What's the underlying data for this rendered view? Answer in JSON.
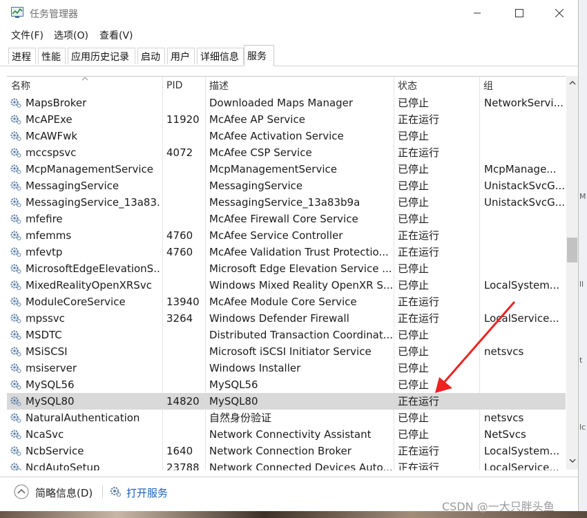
{
  "window": {
    "title": "任务管理器"
  },
  "menu": [
    "文件(F)",
    "选项(O)",
    "查看(V)"
  ],
  "tabs": [
    {
      "label": "进程"
    },
    {
      "label": "性能"
    },
    {
      "label": "应用历史记录"
    },
    {
      "label": "启动"
    },
    {
      "label": "用户"
    },
    {
      "label": "详细信息"
    },
    {
      "label": "服务",
      "active": true
    }
  ],
  "columns": {
    "name": "名称",
    "pid": "PID",
    "desc": "描述",
    "status": "状态",
    "group": "组"
  },
  "rows": [
    {
      "name": "MapsBroker",
      "pid": "",
      "desc": "Downloaded Maps Manager",
      "status": "已停止",
      "group": "NetworkServi..."
    },
    {
      "name": "McAPExe",
      "pid": "11920",
      "desc": "McAfee AP Service",
      "status": "正在运行",
      "group": ""
    },
    {
      "name": "McAWFwk",
      "pid": "",
      "desc": "McAfee Activation Service",
      "status": "已停止",
      "group": ""
    },
    {
      "name": "mccspsvc",
      "pid": "4072",
      "desc": "McAfee CSP Service",
      "status": "正在运行",
      "group": ""
    },
    {
      "name": "McpManagementService",
      "pid": "",
      "desc": "McpManagementService",
      "status": "已停止",
      "group": "McpManage..."
    },
    {
      "name": "MessagingService",
      "pid": "",
      "desc": "MessagingService",
      "status": "已停止",
      "group": "UnistackSvcG..."
    },
    {
      "name": "MessagingService_13a83...",
      "pid": "",
      "desc": "MessagingService_13a83b9a",
      "status": "已停止",
      "group": "UnistackSvcG..."
    },
    {
      "name": "mfefire",
      "pid": "",
      "desc": "McAfee Firewall Core Service",
      "status": "已停止",
      "group": ""
    },
    {
      "name": "mfemms",
      "pid": "4760",
      "desc": "McAfee Service Controller",
      "status": "正在运行",
      "group": ""
    },
    {
      "name": "mfevtp",
      "pid": "4760",
      "desc": "McAfee Validation Trust Protectio...",
      "status": "正在运行",
      "group": ""
    },
    {
      "name": "MicrosoftEdgeElevationS...",
      "pid": "",
      "desc": "Microsoft Edge Elevation Service ...",
      "status": "已停止",
      "group": ""
    },
    {
      "name": "MixedRealityOpenXRSvc",
      "pid": "",
      "desc": "Windows Mixed Reality OpenXR S...",
      "status": "已停止",
      "group": "LocalSystem..."
    },
    {
      "name": "ModuleCoreService",
      "pid": "13940",
      "desc": "McAfee Module Core Service",
      "status": "正在运行",
      "group": ""
    },
    {
      "name": "mpssvc",
      "pid": "3264",
      "desc": "Windows Defender Firewall",
      "status": "正在运行",
      "group": "LocalService..."
    },
    {
      "name": "MSDTC",
      "pid": "",
      "desc": "Distributed Transaction Coordinat...",
      "status": "已停止",
      "group": ""
    },
    {
      "name": "MSiSCSI",
      "pid": "",
      "desc": "Microsoft iSCSI Initiator Service",
      "status": "已停止",
      "group": "netsvcs"
    },
    {
      "name": "msiserver",
      "pid": "",
      "desc": "Windows Installer",
      "status": "已停止",
      "group": ""
    },
    {
      "name": "MySQL56",
      "pid": "",
      "desc": "MySQL56",
      "status": "已停止",
      "group": ""
    },
    {
      "name": "MySQL80",
      "pid": "14820",
      "desc": "MySQL80",
      "status": "正在运行",
      "group": "",
      "selected": true
    },
    {
      "name": "NaturalAuthentication",
      "pid": "",
      "desc": "自然身份验证",
      "status": "已停止",
      "group": "netsvcs"
    },
    {
      "name": "NcaSvc",
      "pid": "",
      "desc": "Network Connectivity Assistant",
      "status": "已停止",
      "group": "NetSvcs"
    },
    {
      "name": "NcbService",
      "pid": "1640",
      "desc": "Network Connection Broker",
      "status": "正在运行",
      "group": "LocalSystem..."
    },
    {
      "name": "NcdAutoSetup",
      "pid": "23788",
      "desc": "Network Connected Devices Auto...",
      "status": "正在运行",
      "group": "LocalService..."
    }
  ],
  "footer": {
    "fewer_details": "简略信息(D)",
    "open_services": "打开服务"
  },
  "watermark": "CSDN @一大只胖头鱼",
  "colors": {
    "accent_link": "#1e61b5",
    "selected_row": "#d9d9d9",
    "annotation_arrow": "#ee2222"
  }
}
